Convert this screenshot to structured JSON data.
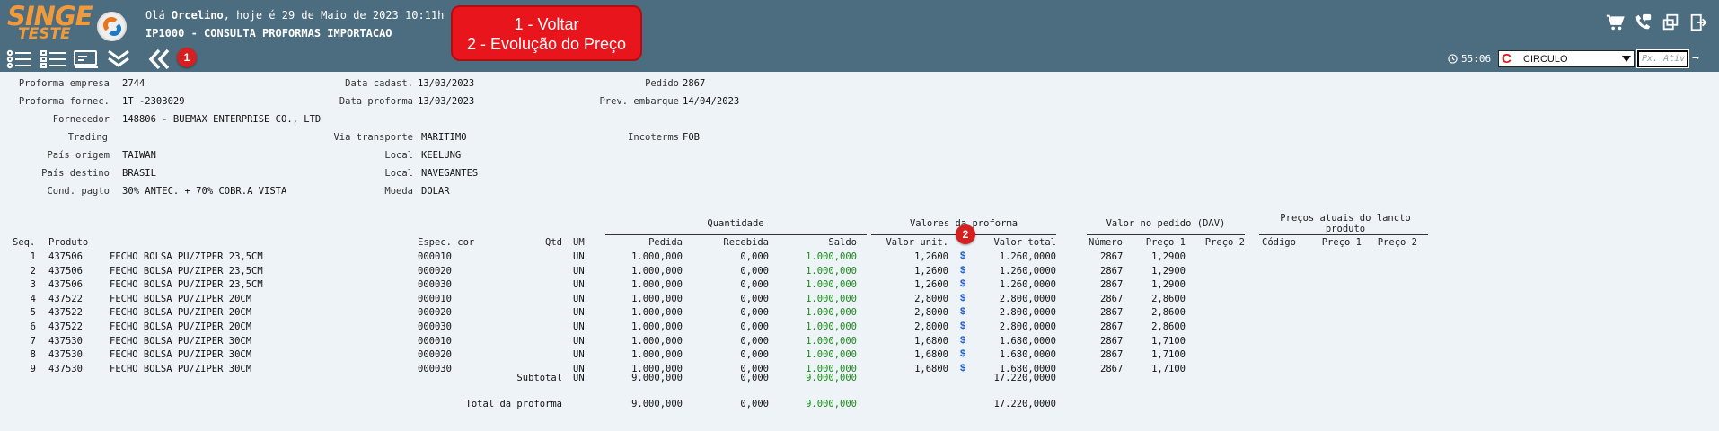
{
  "app": {
    "logo_line1": "SINGE",
    "logo_line2": "TESTE",
    "greeting_prefix": "Olá",
    "user": "Orcelino",
    "greeting_suffix": ", hoje é 29 de Maio de 2023 10:11h",
    "screen_title": "IP1000 - CONSULTA PROFORMAS IMPORTACAO"
  },
  "callout": {
    "line1": "1 - Voltar",
    "line2": "2 - Evolução do Preço"
  },
  "badges": {
    "one": "1",
    "two": "2"
  },
  "toolbar": {
    "timer": "55:06",
    "company_select": "CIRCULO",
    "px_placeholder": "Px. Ativ"
  },
  "icons": {
    "cart": "cart-icon",
    "phone": "phone-chat-icon",
    "windows": "windows-icon",
    "exit": "exit-icon",
    "list1": "list-icon",
    "list2": "checklist-icon",
    "card": "card-icon",
    "chevrons_down": "double-chevron-down-icon",
    "back": "back-icon",
    "clock": "clock-icon"
  },
  "colors": {
    "bar_bg": "#4b6d7f",
    "content_bg": "#eef3f7",
    "accent_orange": "#f29a3a",
    "callout_red": "#e8161c",
    "saldo_green": "#1a8a1a",
    "dollar_blue": "#1e5fc8"
  },
  "header": {
    "proforma_empresa_label": "Proforma empresa",
    "proforma_empresa": "2744",
    "proforma_fornec_label": "Proforma fornec.",
    "proforma_fornec": "1T -2303029",
    "fornecedor_label": "Fornecedor",
    "fornecedor": "148806 - BUEMAX ENTERPRISE CO., LTD",
    "trading_label": "Trading",
    "trading": "",
    "pais_origem_label": "País origem",
    "pais_origem": "TAIWAN",
    "pais_destino_label": "País destino",
    "pais_destino": "BRASIL",
    "cond_pagto_label": "Cond. pagto",
    "cond_pagto": "30% ANTEC. + 70% COBR.A VISTA",
    "data_cadast_label": "Data cadast.",
    "data_cadast": "13/03/2023",
    "data_proforma_label": "Data proforma",
    "data_proforma": "13/03/2023",
    "via_transporte_label": "Via transporte",
    "via_transporte": "MARITIMO",
    "local1_label": "Local",
    "local1": "KEELUNG",
    "local2_label": "Local",
    "local2": "NAVEGANTES",
    "moeda_label": "Moeda",
    "moeda": "DOLAR",
    "pedido_label": "Pedido",
    "pedido": "2867",
    "prev_embarque_label": "Prev. embarque",
    "prev_embarque": "14/04/2023",
    "incoterms_label": "Incoterms",
    "incoterms": "FOB"
  },
  "table": {
    "groups": {
      "quantidade": "Quantidade",
      "valores_proforma": "Valores da proforma",
      "valor_pedido": "Valor no pedido (DAV)",
      "precos_atuais_1": "Preços atuais do lancto",
      "precos_atuais_2": "produto"
    },
    "columns": {
      "seq": "Seq.",
      "produto": "Produto",
      "espec_cor": "Espec. cor",
      "qtd": "Qtd",
      "um": "UM",
      "pedida": "Pedida",
      "recebida": "Recebida",
      "saldo": "Saldo",
      "valor_unit": "Valor unit.",
      "valor_total": "Valor total",
      "numero": "Número",
      "preco1": "Preço 1",
      "preco2": "Preço 2",
      "codigo": "Código",
      "preco1b": "Preço 1",
      "preco2b": "Preço 2"
    },
    "dollar_sign": "$",
    "rows": [
      {
        "seq": "1",
        "cod": "437506",
        "desc": "FECHO BOLSA PU/ZIPER 23,5CM",
        "cor": "000010",
        "um": "UN",
        "pedida": "1.000,000",
        "recebida": "0,000",
        "saldo": "1.000,000",
        "unit": "1,2600",
        "total": "1.260,0000",
        "numero": "2867",
        "preco1": "1,2900"
      },
      {
        "seq": "2",
        "cod": "437506",
        "desc": "FECHO BOLSA PU/ZIPER 23,5CM",
        "cor": "000020",
        "um": "UN",
        "pedida": "1.000,000",
        "recebida": "0,000",
        "saldo": "1.000,000",
        "unit": "1,2600",
        "total": "1.260,0000",
        "numero": "2867",
        "preco1": "1,2900"
      },
      {
        "seq": "3",
        "cod": "437506",
        "desc": "FECHO BOLSA PU/ZIPER 23,5CM",
        "cor": "000030",
        "um": "UN",
        "pedida": "1.000,000",
        "recebida": "0,000",
        "saldo": "1.000,000",
        "unit": "1,2600",
        "total": "1.260,0000",
        "numero": "2867",
        "preco1": "1,2900"
      },
      {
        "seq": "4",
        "cod": "437522",
        "desc": "FECHO BOLSA PU/ZIPER 20CM",
        "cor": "000010",
        "um": "UN",
        "pedida": "1.000,000",
        "recebida": "0,000",
        "saldo": "1.000,000",
        "unit": "2,8000",
        "total": "2.800,0000",
        "numero": "2867",
        "preco1": "2,8600"
      },
      {
        "seq": "5",
        "cod": "437522",
        "desc": "FECHO BOLSA PU/ZIPER 20CM",
        "cor": "000020",
        "um": "UN",
        "pedida": "1.000,000",
        "recebida": "0,000",
        "saldo": "1.000,000",
        "unit": "2,8000",
        "total": "2.800,0000",
        "numero": "2867",
        "preco1": "2,8600"
      },
      {
        "seq": "6",
        "cod": "437522",
        "desc": "FECHO BOLSA PU/ZIPER 20CM",
        "cor": "000030",
        "um": "UN",
        "pedida": "1.000,000",
        "recebida": "0,000",
        "saldo": "1.000,000",
        "unit": "2,8000",
        "total": "2.800,0000",
        "numero": "2867",
        "preco1": "2,8600"
      },
      {
        "seq": "7",
        "cod": "437530",
        "desc": "FECHO BOLSA PU/ZIPER 30CM",
        "cor": "000010",
        "um": "UN",
        "pedida": "1.000,000",
        "recebida": "0,000",
        "saldo": "1.000,000",
        "unit": "1,6800",
        "total": "1.680,0000",
        "numero": "2867",
        "preco1": "1,7100"
      },
      {
        "seq": "8",
        "cod": "437530",
        "desc": "FECHO BOLSA PU/ZIPER 30CM",
        "cor": "000020",
        "um": "UN",
        "pedida": "1.000,000",
        "recebida": "0,000",
        "saldo": "1.000,000",
        "unit": "1,6800",
        "total": "1.680,0000",
        "numero": "2867",
        "preco1": "1,7100"
      },
      {
        "seq": "9",
        "cod": "437530",
        "desc": "FECHO BOLSA PU/ZIPER 30CM",
        "cor": "000030",
        "um": "UN",
        "pedida": "1.000,000",
        "recebida": "0,000",
        "saldo": "1.000,000",
        "unit": "1,6800",
        "total": "1.680,0000",
        "numero": "2867",
        "preco1": "1,7100"
      }
    ],
    "subtotal": {
      "label": "Subtotal",
      "um": "UN",
      "pedida": "9.000,000",
      "recebida": "0,000",
      "saldo": "9.000,000",
      "total": "17.220,0000"
    },
    "total": {
      "label": "Total da proforma",
      "pedida": "9.000,000",
      "recebida": "0,000",
      "saldo": "9.000,000",
      "total": "17.220,0000"
    }
  }
}
